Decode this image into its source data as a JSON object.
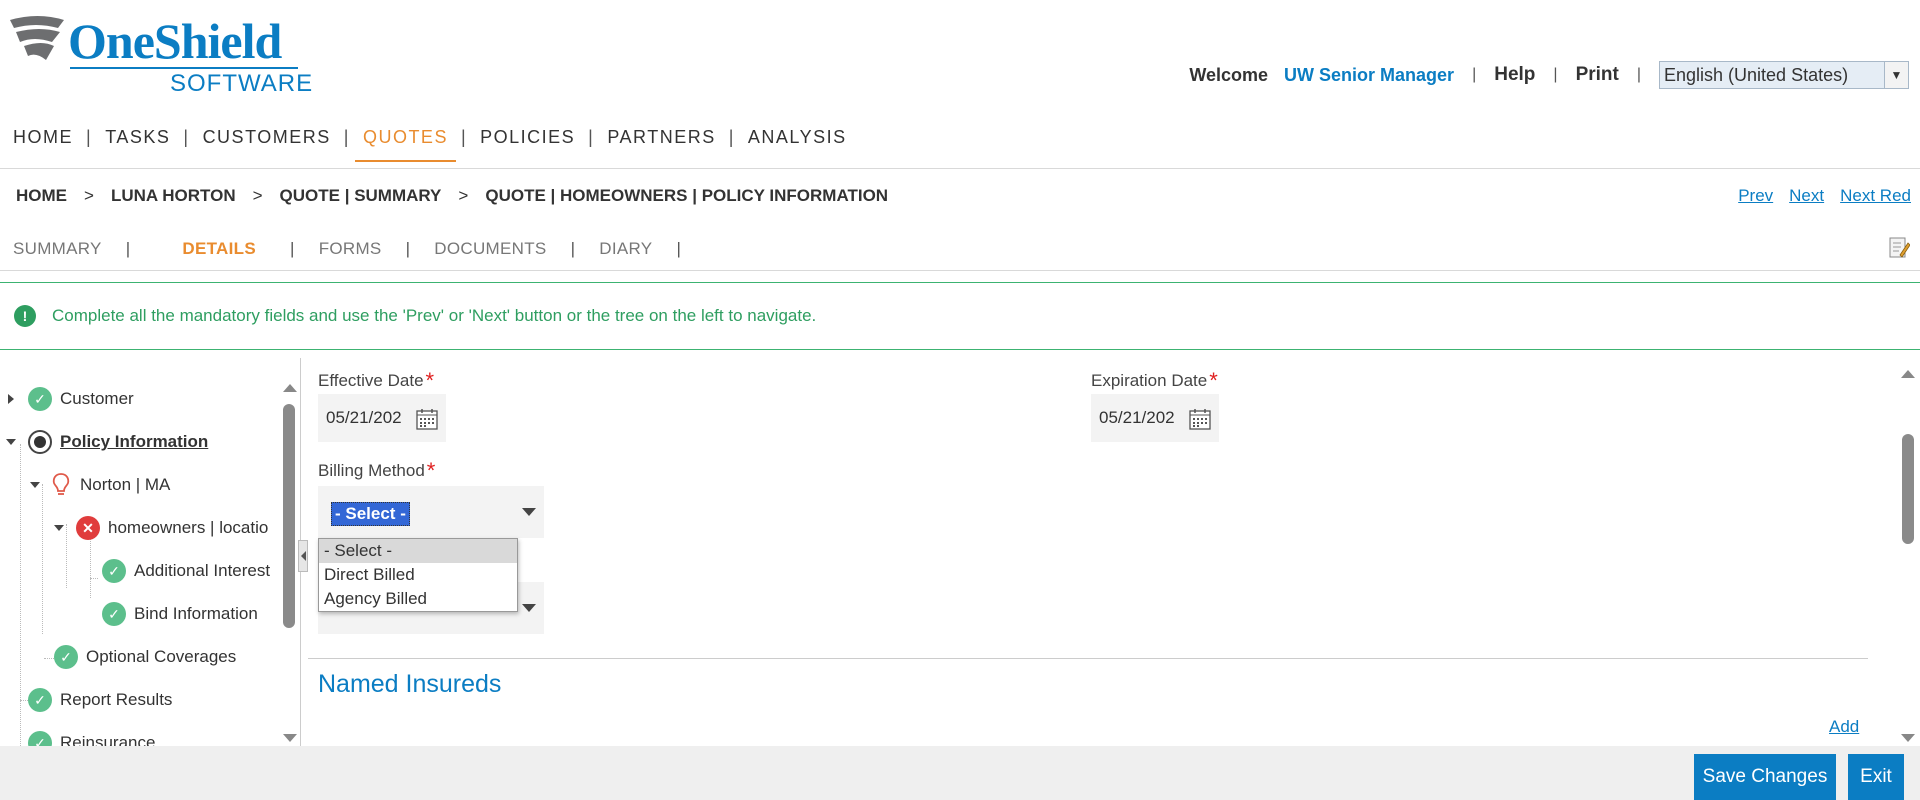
{
  "brand": {
    "name": "OneShield",
    "sub": "SOFTWARE",
    "color": "#0b7dc3"
  },
  "userbar": {
    "welcome": "Welcome",
    "user": "UW Senior Manager",
    "help": "Help",
    "print": "Print",
    "language": "English (United States)"
  },
  "mainnav": [
    "HOME",
    "TASKS",
    "CUSTOMERS",
    "QUOTES",
    "POLICIES",
    "PARTNERS",
    "ANALYSIS"
  ],
  "mainnav_active": "QUOTES",
  "breadcrumb": [
    "HOME",
    "LUNA HORTON",
    "QUOTE | SUMMARY",
    "QUOTE | HOMEOWNERS | POLICY INFORMATION"
  ],
  "pager": {
    "prev": "Prev",
    "next": "Next",
    "next_red": "Next Red"
  },
  "subtabs": [
    "SUMMARY",
    "DETAILS",
    "FORMS",
    "DOCUMENTS",
    "DIARY"
  ],
  "subtabs_active": "DETAILS",
  "message": {
    "icon": "!",
    "text": "Complete all the mandatory fields and use the 'Prev' or 'Next' button or the tree on the left to navigate."
  },
  "tree": [
    {
      "label": "Customer",
      "status": "complete",
      "expander": "collapsed"
    },
    {
      "label": "Policy Information",
      "status": "current",
      "expander": "expanded"
    },
    {
      "label": "Norton | MA",
      "status": "location",
      "expander": "expanded"
    },
    {
      "label": "homeowners | locatio",
      "status": "error",
      "expander": "expanded"
    },
    {
      "label": "Additional Interest",
      "status": "complete"
    },
    {
      "label": "Bind Information",
      "status": "complete"
    },
    {
      "label": "Optional Coverages",
      "status": "complete"
    },
    {
      "label": "Report Results",
      "status": "complete"
    },
    {
      "label": "Reinsurance",
      "status": "complete"
    }
  ],
  "form": {
    "effective_date_label": "Effective Date",
    "effective_date_value": "05/21/202",
    "expiration_date_label": "Expiration Date",
    "expiration_date_value": "05/21/202",
    "required_mark": "*",
    "billing_method_label": "Billing Method",
    "billing_method_value": "- Select -",
    "billing_method_options": [
      "- Select -",
      "Direct Billed",
      "Agency Billed"
    ]
  },
  "section": {
    "title": "Named Insureds",
    "add": "Add"
  },
  "footer": {
    "save": "Save Changes",
    "exit": "Exit"
  },
  "colors": {
    "accent": "#0b7dc3",
    "active_tab": "#e98c2f",
    "success": "#2e9e60",
    "error": "#e03c3c",
    "required": "#e02020"
  }
}
